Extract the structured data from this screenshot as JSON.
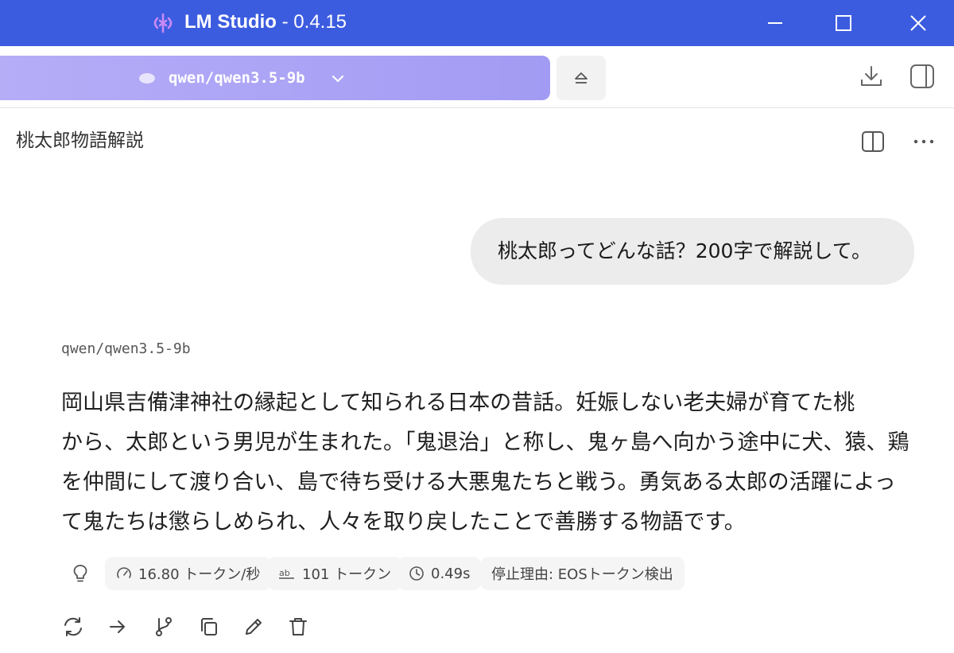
{
  "window": {
    "app_name": "LM Studio",
    "version_suffix": " - 0.4.15",
    "logo_icon": "lm-studio-logo-icon",
    "controls": [
      "minimize-icon",
      "maximize-icon",
      "close-icon"
    ],
    "title_bar_color": "#3c5ce0"
  },
  "toolbar": {
    "model_selector": {
      "model_name": "qwen/qwen3.5-9b",
      "chevron_icon": "chevron-down-icon",
      "color": "#a29bf3"
    },
    "eject_icon": "eject-icon",
    "download_icon": "download-icon",
    "sidebar_icon": "panel-right-icon"
  },
  "chat": {
    "title": "桃太郎物語解説",
    "split_view_icon": "split-view-icon",
    "more_icon": "more-horizontal-icon"
  },
  "messages": {
    "user": {
      "text": "桃太郎ってどんな話？200字で解説して。"
    },
    "assistant": {
      "model": "qwen/qwen3.5-9b",
      "lines": [
        "岡山県吉備津神社の縁起として知られる日本の昔話。妊娠しない老夫婦が育てた桃",
        "から、太郎という男児が生まれた。「鬼退治」と称し、鬼ヶ島へ向かう途中に犬、猿、鶏",
        "を仲間にして渡り合い、島で待ち受ける大悪鬼たちと戦う。勇気ある太郎の活躍によっ",
        "て鬼たちは懲らしめられ、人々を取り戻したことで善勝する物語です。"
      ],
      "stats": {
        "thinking_icon": "lightbulb-icon",
        "speed": "16.80 トークン/秒",
        "tokens": "101 トークン",
        "time": "0.49s",
        "stop_reason": "停止理由: EOSトークン検出"
      },
      "actions": [
        "regenerate-icon",
        "continue-icon",
        "branch-icon",
        "copy-icon",
        "edit-icon",
        "delete-icon"
      ]
    }
  }
}
